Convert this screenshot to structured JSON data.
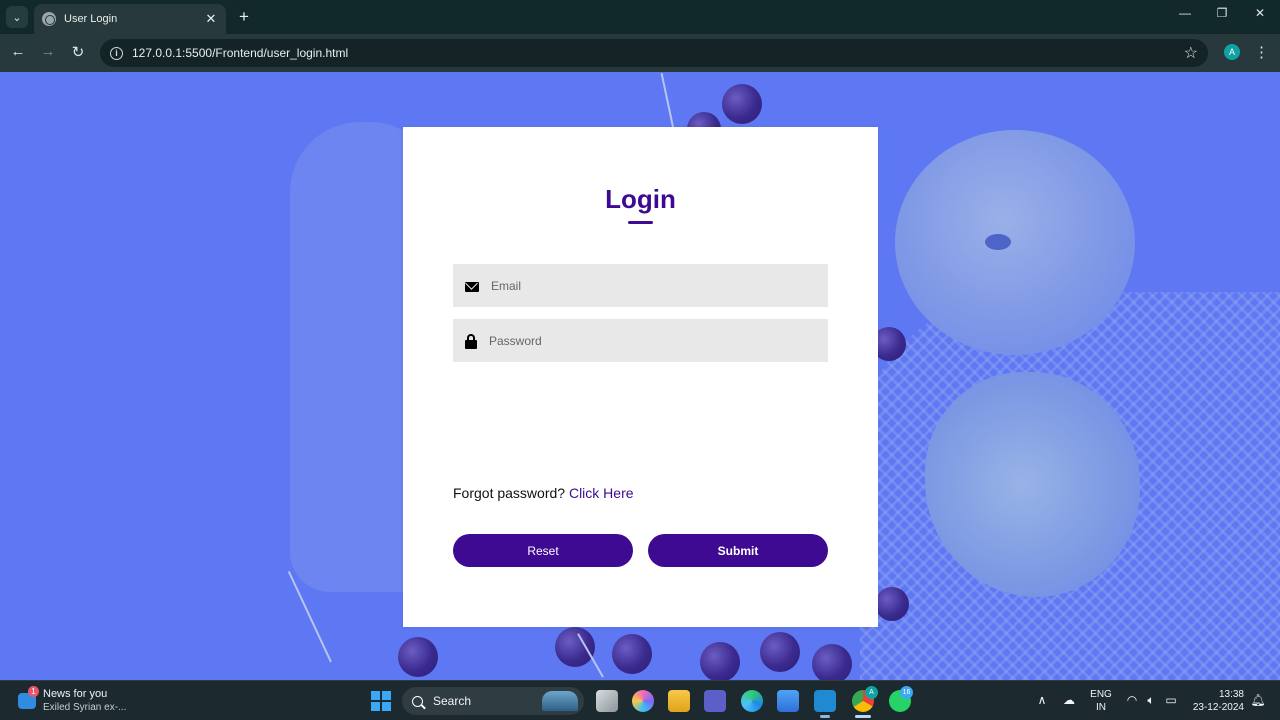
{
  "browser": {
    "tab_title": "User Login",
    "new_tab_symbol": "+",
    "url": "127.0.0.1:5500/Frontend/user_login.html",
    "profile_initial": "A"
  },
  "login": {
    "title": "Login",
    "email_placeholder": "Email",
    "password_placeholder": "Password",
    "forgot_text": "Forgot password?",
    "forgot_link": "Click Here",
    "reset_label": "Reset",
    "submit_label": "Submit",
    "accent_color": "#3d0a91"
  },
  "taskbar": {
    "news_badge": "1",
    "news_title": "News for you",
    "news_subtitle": "Exiled Syrian ex-...",
    "search_label": "Search",
    "teams_badge": "A",
    "whatsapp_badge": "16",
    "lang_line1": "ENG",
    "lang_line2": "IN",
    "time": "13:38",
    "date": "23-12-2024"
  }
}
